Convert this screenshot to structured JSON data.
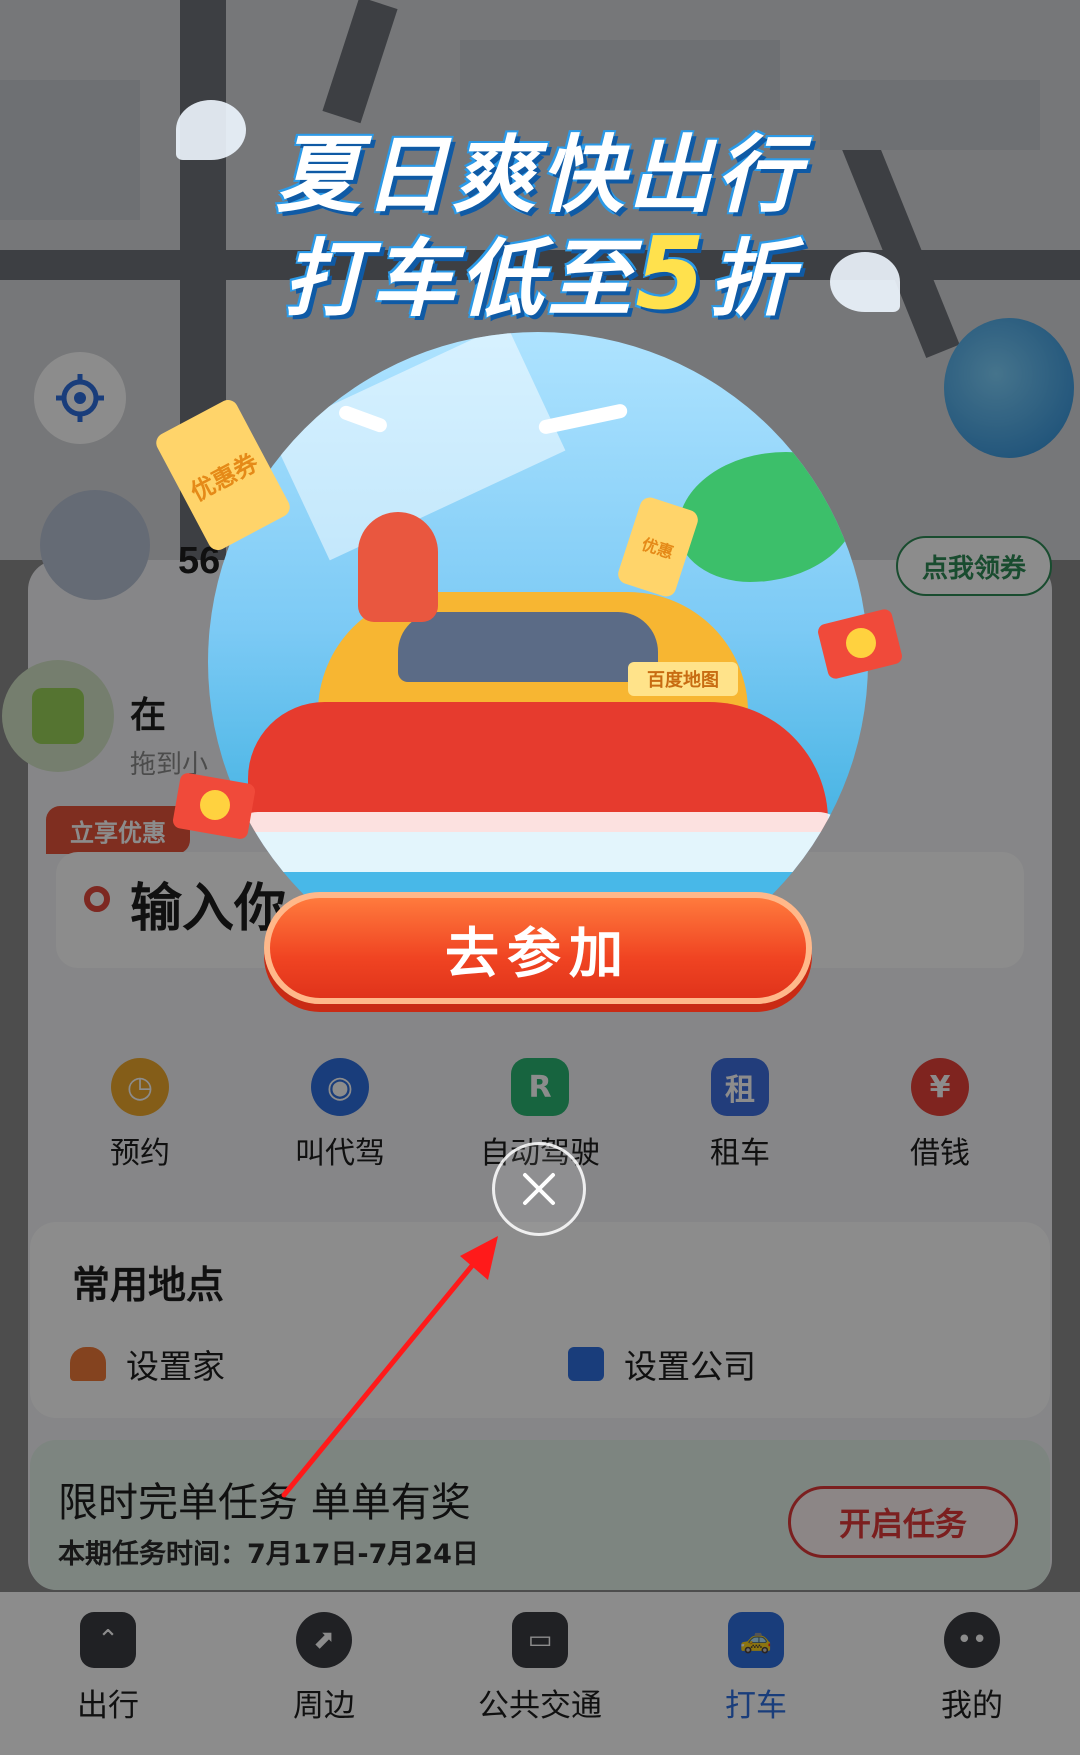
{
  "map": {
    "locate_icon": "locate-icon"
  },
  "robot": {
    "count": "56"
  },
  "coupon_button": "点我领券",
  "location": {
    "title": "在",
    "subtitle": "拖到小"
  },
  "search": {
    "tag": "立享优惠",
    "placeholder": "输入你"
  },
  "services": [
    {
      "label": "预约",
      "icon": "clock-icon",
      "color": "#f0a92c",
      "glyph": "◷"
    },
    {
      "label": "叫代驾",
      "icon": "driver-icon",
      "color": "#2f6fe0",
      "glyph": "◉"
    },
    {
      "label": "自动驾驶",
      "icon": "autodrive-icon",
      "color": "#2bb673",
      "glyph": "R"
    },
    {
      "label": "租车",
      "icon": "rent-car-icon",
      "color": "#3f6fe0",
      "glyph": "租"
    },
    {
      "label": "借钱",
      "icon": "money-bag-icon",
      "color": "#e8433a",
      "glyph": "¥"
    }
  ],
  "places": {
    "title": "常用地点",
    "home": {
      "label": "设置家",
      "icon": "home-icon",
      "color": "#f07a3a"
    },
    "company": {
      "label": "设置公司",
      "icon": "briefcase-icon",
      "color": "#2f6fe0"
    }
  },
  "task": {
    "title": "限时完单任务 单单有奖",
    "time": "本期任务时间：7月17日-7月24日",
    "button": "开启任务"
  },
  "tabs": [
    {
      "label": "出行",
      "icon": "travel-icon",
      "active": false
    },
    {
      "label": "周边",
      "icon": "compass-icon",
      "active": false
    },
    {
      "label": "公共交通",
      "icon": "bus-icon",
      "active": false
    },
    {
      "label": "打车",
      "icon": "taxi-icon",
      "active": true
    },
    {
      "label": "我的",
      "icon": "profile-icon",
      "active": false
    }
  ],
  "popup": {
    "title_line1": "夏日爽快出行",
    "title_line2_prefix": "打车低至",
    "title_line2_highlight": "5",
    "title_line2_suffix": "折",
    "plate": "百度地图",
    "ticket_left": "优惠券",
    "ticket_right": "优惠",
    "cta": "去参加",
    "close_icon": "close-icon"
  },
  "annotation": {
    "arrow_color": "#ff1a1a"
  }
}
